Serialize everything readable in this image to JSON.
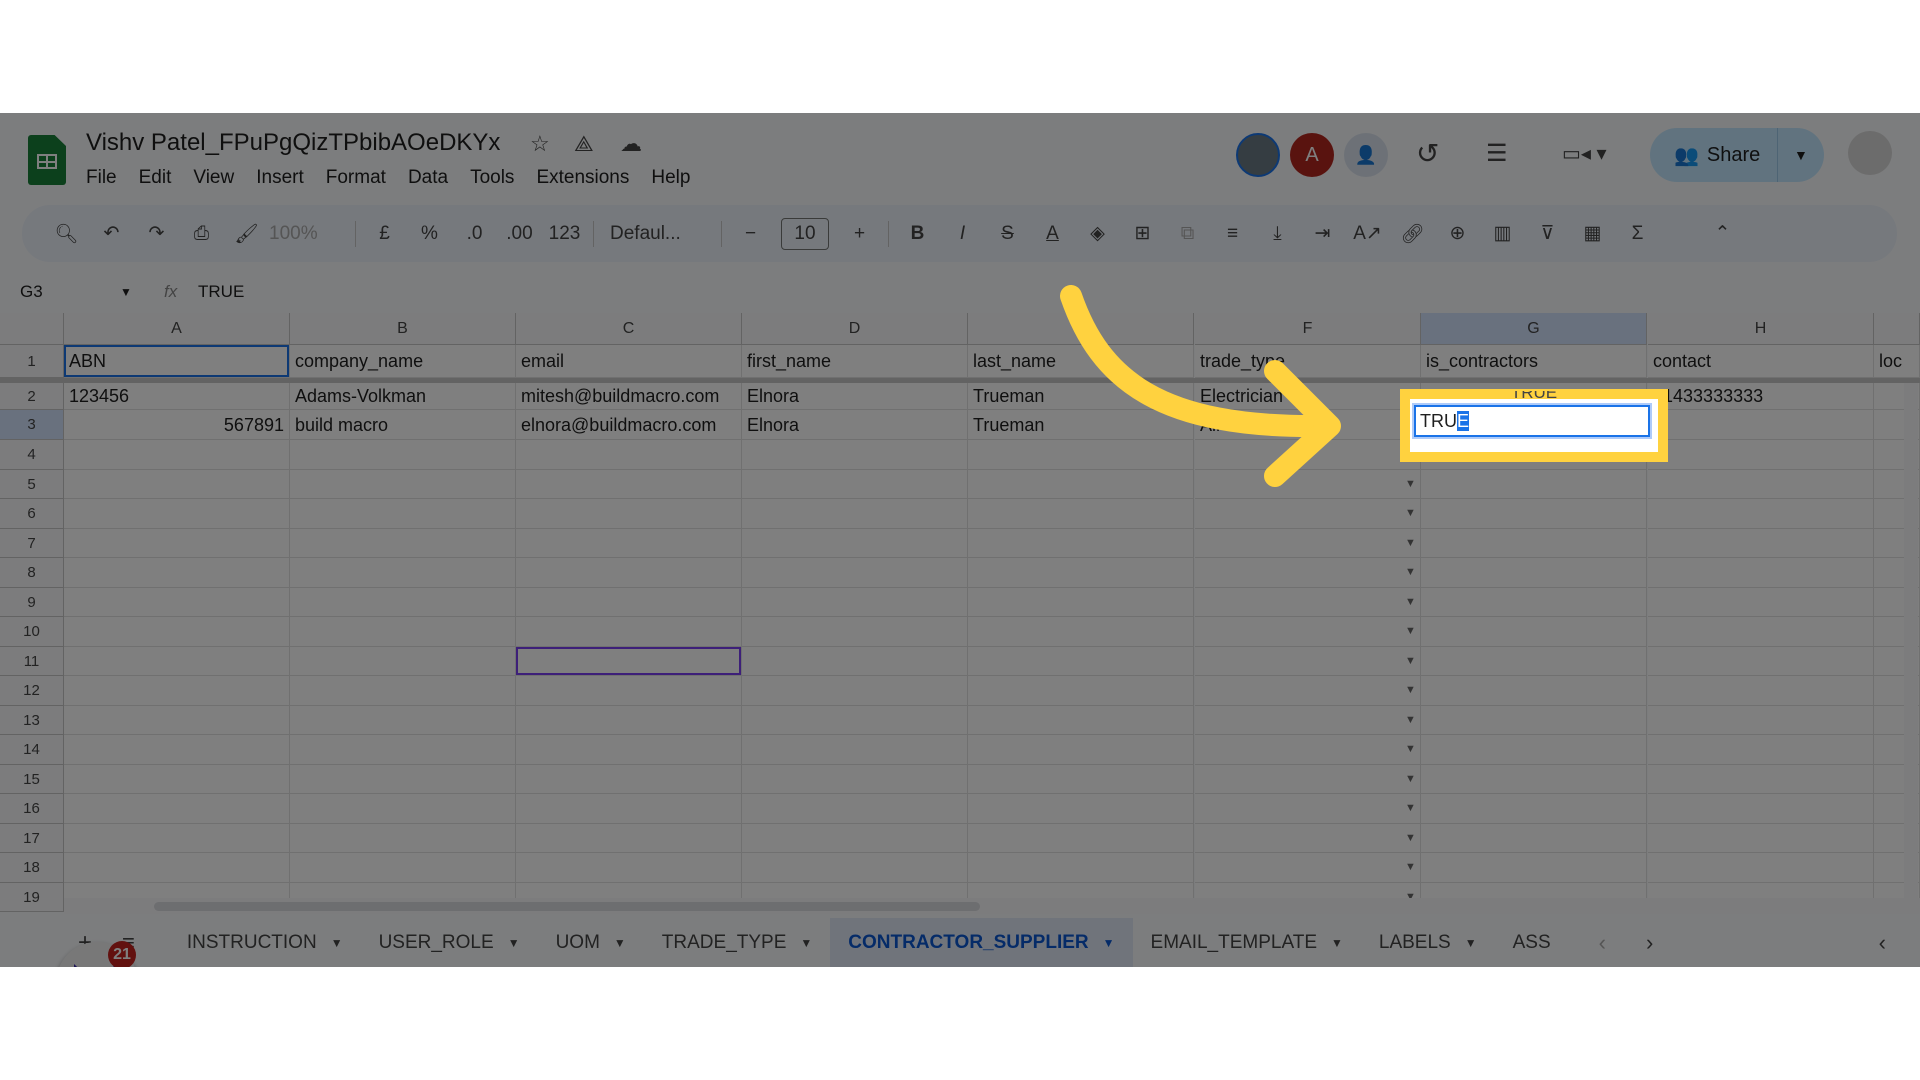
{
  "doc": {
    "title": "Vishv Patel_FPuPgQizTPbibAOeDKYx"
  },
  "menu": [
    "File",
    "Edit",
    "View",
    "Insert",
    "Format",
    "Data",
    "Tools",
    "Extensions",
    "Help"
  ],
  "header": {
    "avatar_letter": "A",
    "share_label": "Share"
  },
  "toolbar": {
    "zoom": "100%",
    "currency": "£",
    "percent": "%",
    "dec_decrease": ".0",
    "dec_increase": ".00",
    "number_format": "123",
    "font": "Defaul...",
    "font_size": "10"
  },
  "formula_bar": {
    "cell_ref": "G3",
    "fx": "fx",
    "value": "TRUE"
  },
  "columns": [
    "A",
    "B",
    "C",
    "D",
    "E",
    "F",
    "G",
    "H"
  ],
  "rows": [
    [
      "ABN",
      "company_name",
      "email",
      "first_name",
      "last_name",
      "trade_type",
      "is_contractors",
      "contact",
      "loc"
    ],
    [
      "123456",
      "Adams-Volkman",
      "mitesh@buildmacro.com",
      "Elnora",
      "Trueman",
      "Electrician",
      "TRUE",
      "61433333333",
      ""
    ],
    [
      "567891",
      "build macro",
      "elnora@buildmacro.com",
      "Elnora",
      "Trueman",
      "Air Conditioner",
      "",
      "",
      ""
    ]
  ],
  "row_numbers": [
    "1",
    "2",
    "3",
    "4",
    "5",
    "6",
    "7",
    "8",
    "9",
    "10",
    "11",
    "12",
    "13",
    "14",
    "15",
    "16",
    "17",
    "18",
    "19"
  ],
  "editing": {
    "cell": "G3",
    "text_before": "TRU",
    "text_selected": "E"
  },
  "sheet_tabs": [
    {
      "label": "INSTRUCTION",
      "active": false
    },
    {
      "label": "USER_ROLE",
      "active": false
    },
    {
      "label": "UOM",
      "active": false
    },
    {
      "label": "TRADE_TYPE",
      "active": false
    },
    {
      "label": "CONTRACTOR_SUPPLIER",
      "active": true
    },
    {
      "label": "EMAIL_TEMPLATE",
      "active": false
    },
    {
      "label": "LABELS",
      "active": false
    },
    {
      "label": "ASS",
      "active": false
    }
  ],
  "extension": {
    "badge_count": "21"
  },
  "colors": {
    "highlight": "#ffd23f",
    "arrow": "#ffd23f",
    "active_tab": "#0b57d0",
    "selection": "#1a73e8"
  }
}
